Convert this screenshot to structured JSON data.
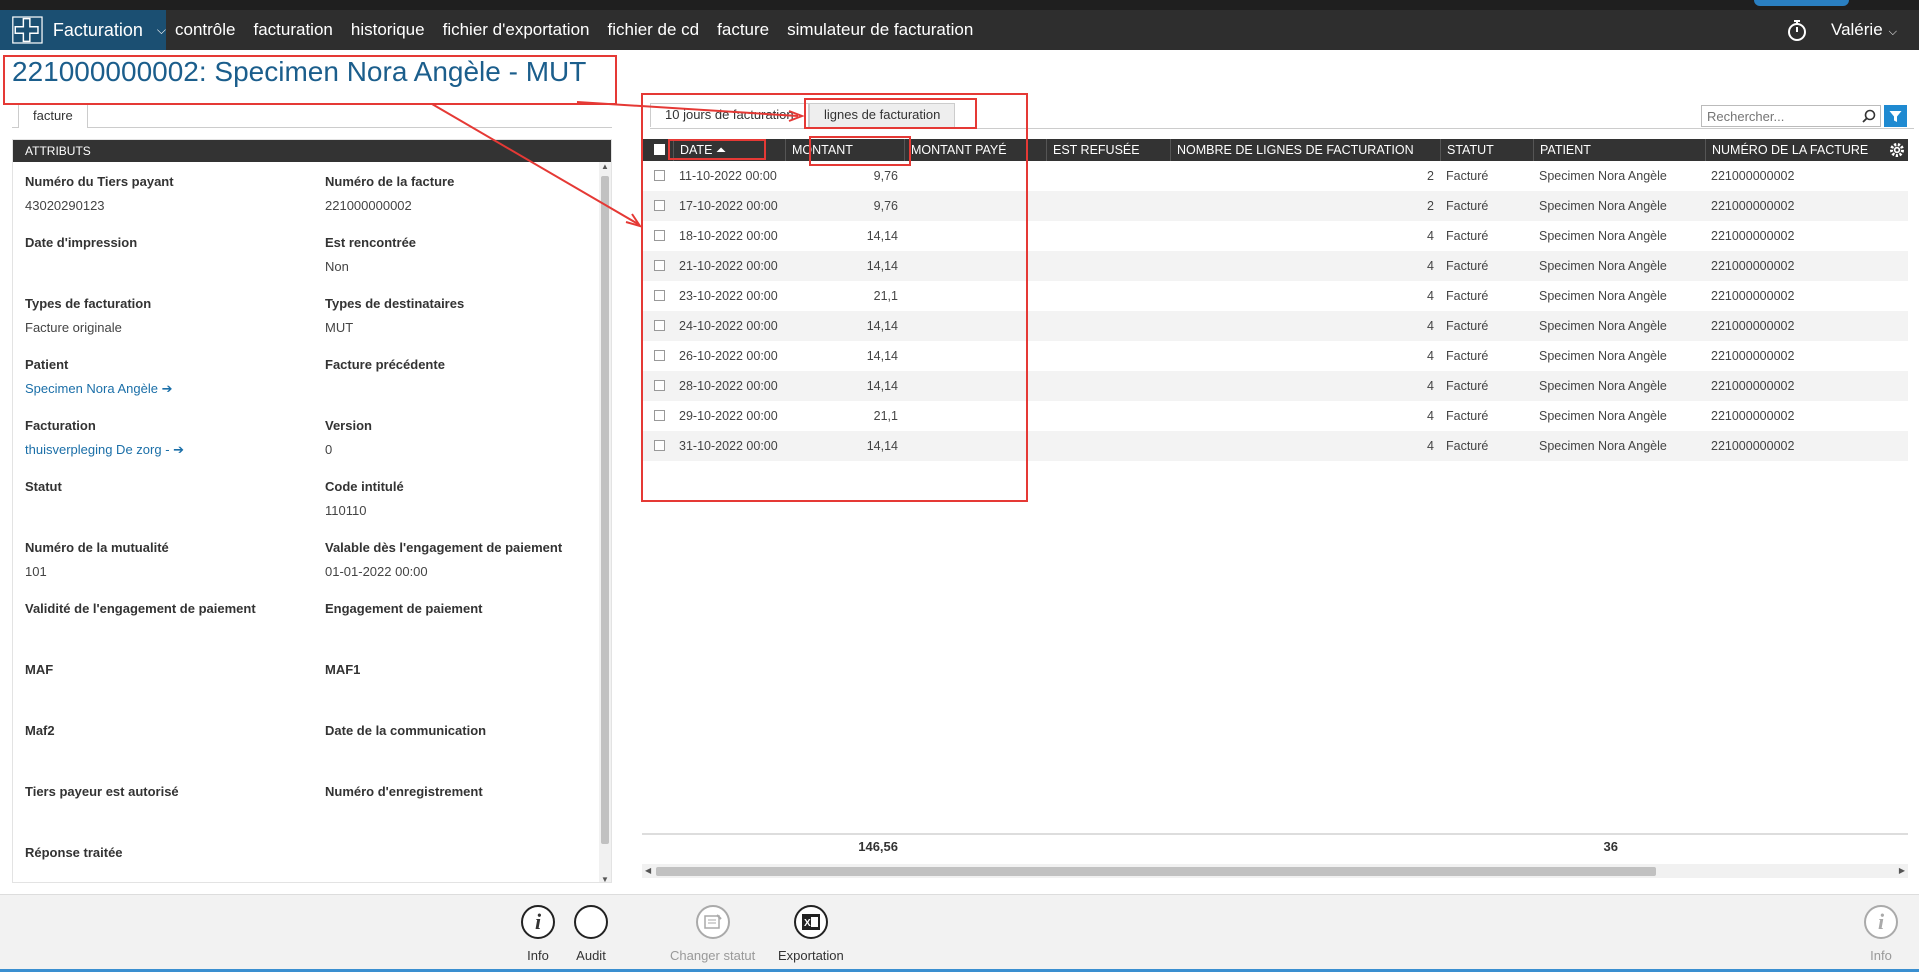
{
  "nav": {
    "brand_label": "Facturation",
    "items": [
      "contrôle",
      "facturation",
      "historique",
      "fichier d'exportation",
      "fichier de cd",
      "facture",
      "simulateur de facturation"
    ],
    "user": "Valérie"
  },
  "page": {
    "title": "221000000002: Specimen Nora Angèle - MUT"
  },
  "left": {
    "tab": "facture",
    "section": "ATTRIBUTS",
    "attributes": [
      {
        "label": "Numéro du Tiers payant",
        "value": "43020290123"
      },
      {
        "label": "Numéro de la facture",
        "value": "221000000002"
      },
      {
        "label": "Date d'impression",
        "value": ""
      },
      {
        "label": "Est rencontrée",
        "value": "Non"
      },
      {
        "label": "Types de facturation",
        "value": "Facture originale"
      },
      {
        "label": "Types de destinataires",
        "value": "MUT"
      },
      {
        "label": "Patient",
        "value": "Specimen Nora Angèle ➔"
      },
      {
        "label": "Facture précédente",
        "value": ""
      },
      {
        "label": "Facturation",
        "value": "thuisverpleging De zorg - ➔"
      },
      {
        "label": "Version",
        "value": "0"
      },
      {
        "label": "Statut",
        "value": ""
      },
      {
        "label": "Code intitulé",
        "value": "110110"
      },
      {
        "label": "Numéro de la mutualité",
        "value": "101"
      },
      {
        "label": "Valable dès l'engagement de paiement",
        "value": "01-01-2022 00:00"
      },
      {
        "label": "Validité de l'engagement de paiement",
        "value": ""
      },
      {
        "label": "Engagement de paiement",
        "value": ""
      },
      {
        "label": "MAF",
        "value": ""
      },
      {
        "label": "MAF1",
        "value": ""
      },
      {
        "label": "Maf2",
        "value": ""
      },
      {
        "label": "Date de la communication",
        "value": ""
      },
      {
        "label": "Tiers payeur est autorisé",
        "value": ""
      },
      {
        "label": "Numéro d'enregistrement",
        "value": ""
      },
      {
        "label": "Réponse traitée",
        "value": ""
      }
    ]
  },
  "right": {
    "tabs": [
      "10 jours de facturation",
      "lignes de facturation"
    ],
    "search_placeholder": "Rechercher...",
    "columns": [
      "DATE ⏶",
      "MONTANT",
      "MONTANT PAYÉ",
      "EST REFUSÉE",
      "NOMBRE DE LIGNES DE FACTURATION",
      "STATUT",
      "PATIENT",
      "NUMÉRO DE LA FACTURE"
    ],
    "rows": [
      {
        "date": "11-10-2022 00:00",
        "montant": "9,76",
        "paye": "",
        "refusee": "",
        "lignes": "2",
        "statut": "Facturé",
        "patient": "Specimen Nora Angèle",
        "numero": "221000000002"
      },
      {
        "date": "17-10-2022 00:00",
        "montant": "9,76",
        "paye": "",
        "refusee": "",
        "lignes": "2",
        "statut": "Facturé",
        "patient": "Specimen Nora Angèle",
        "numero": "221000000002"
      },
      {
        "date": "18-10-2022 00:00",
        "montant": "14,14",
        "paye": "",
        "refusee": "",
        "lignes": "4",
        "statut": "Facturé",
        "patient": "Specimen Nora Angèle",
        "numero": "221000000002"
      },
      {
        "date": "21-10-2022 00:00",
        "montant": "14,14",
        "paye": "",
        "refusee": "",
        "lignes": "4",
        "statut": "Facturé",
        "patient": "Specimen Nora Angèle",
        "numero": "221000000002"
      },
      {
        "date": "23-10-2022 00:00",
        "montant": "21,1",
        "paye": "",
        "refusee": "",
        "lignes": "4",
        "statut": "Facturé",
        "patient": "Specimen Nora Angèle",
        "numero": "221000000002"
      },
      {
        "date": "24-10-2022 00:00",
        "montant": "14,14",
        "paye": "",
        "refusee": "",
        "lignes": "4",
        "statut": "Facturé",
        "patient": "Specimen Nora Angèle",
        "numero": "221000000002"
      },
      {
        "date": "26-10-2022 00:00",
        "montant": "14,14",
        "paye": "",
        "refusee": "",
        "lignes": "4",
        "statut": "Facturé",
        "patient": "Specimen Nora Angèle",
        "numero": "221000000002"
      },
      {
        "date": "28-10-2022 00:00",
        "montant": "14,14",
        "paye": "",
        "refusee": "",
        "lignes": "4",
        "statut": "Facturé",
        "patient": "Specimen Nora Angèle",
        "numero": "221000000002"
      },
      {
        "date": "29-10-2022 00:00",
        "montant": "21,1",
        "paye": "",
        "refusee": "",
        "lignes": "4",
        "statut": "Facturé",
        "patient": "Specimen Nora Angèle",
        "numero": "221000000002"
      },
      {
        "date": "31-10-2022 00:00",
        "montant": "14,14",
        "paye": "",
        "refusee": "",
        "lignes": "4",
        "statut": "Facturé",
        "patient": "Specimen Nora Angèle",
        "numero": "221000000002"
      }
    ],
    "totals": {
      "montant": "146,56",
      "lignes": "36"
    }
  },
  "toolbar": {
    "items": [
      {
        "label": "Info",
        "icon": "info-icon",
        "enabled": true
      },
      {
        "label": "Audit",
        "icon": "audit-icon",
        "enabled": true
      },
      {
        "label": "Changer statut",
        "icon": "change-status-icon",
        "enabled": false
      },
      {
        "label": "Exportation",
        "icon": "excel-export-icon",
        "enabled": true
      }
    ],
    "right_item": {
      "label": "Info",
      "icon": "info-icon",
      "enabled": false
    }
  },
  "colors": {
    "nav_bg": "#2e2e2e",
    "brand_bg": "#1b4f72",
    "title": "#1b5e8c",
    "link": "#1b6fa8",
    "annotation": "#e53935",
    "filter": "#1f8ad1"
  }
}
